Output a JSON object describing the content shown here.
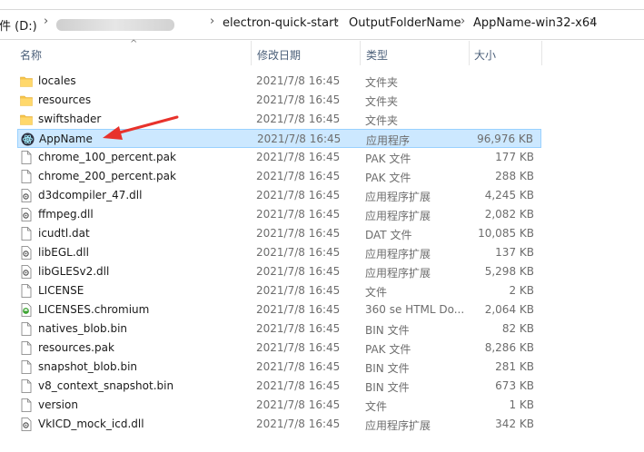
{
  "breadcrumb": {
    "drive_label": "文件 (D:)",
    "segments": [
      "electron-quick-start",
      "OutputFolderName",
      "AppName-win32-x64"
    ]
  },
  "columns": {
    "name": "名称",
    "date": "修改日期",
    "type": "类型",
    "size": "大小"
  },
  "files": [
    {
      "name": "locales",
      "date": "2021/7/8 16:45",
      "type": "文件夹",
      "size": "",
      "icon": "folder-icon"
    },
    {
      "name": "resources",
      "date": "2021/7/8 16:45",
      "type": "文件夹",
      "size": "",
      "icon": "folder-icon"
    },
    {
      "name": "swiftshader",
      "date": "2021/7/8 16:45",
      "type": "文件夹",
      "size": "",
      "icon": "folder-icon"
    },
    {
      "name": "AppName",
      "date": "2021/7/8 16:45",
      "type": "应用程序",
      "size": "96,976 KB",
      "icon": "electron-app-icon",
      "selected": true
    },
    {
      "name": "chrome_100_percent.pak",
      "date": "2021/7/8 16:45",
      "type": "PAK 文件",
      "size": "177 KB",
      "icon": "file-icon"
    },
    {
      "name": "chrome_200_percent.pak",
      "date": "2021/7/8 16:45",
      "type": "PAK 文件",
      "size": "288 KB",
      "icon": "file-icon"
    },
    {
      "name": "d3dcompiler_47.dll",
      "date": "2021/7/8 16:45",
      "type": "应用程序扩展",
      "size": "4,245 KB",
      "icon": "dll-icon"
    },
    {
      "name": "ffmpeg.dll",
      "date": "2021/7/8 16:45",
      "type": "应用程序扩展",
      "size": "2,082 KB",
      "icon": "dll-icon"
    },
    {
      "name": "icudtl.dat",
      "date": "2021/7/8 16:45",
      "type": "DAT 文件",
      "size": "10,085 KB",
      "icon": "file-icon"
    },
    {
      "name": "libEGL.dll",
      "date": "2021/7/8 16:45",
      "type": "应用程序扩展",
      "size": "137 KB",
      "icon": "dll-icon"
    },
    {
      "name": "libGLESv2.dll",
      "date": "2021/7/8 16:45",
      "type": "应用程序扩展",
      "size": "5,298 KB",
      "icon": "dll-icon"
    },
    {
      "name": "LICENSE",
      "date": "2021/7/8 16:45",
      "type": "文件",
      "size": "2 KB",
      "icon": "file-icon"
    },
    {
      "name": "LICENSES.chromium",
      "date": "2021/7/8 16:45",
      "type": "360 se HTML Do...",
      "size": "2,064 KB",
      "icon": "html-doc-icon"
    },
    {
      "name": "natives_blob.bin",
      "date": "2021/7/8 16:45",
      "type": "BIN 文件",
      "size": "82 KB",
      "icon": "file-icon"
    },
    {
      "name": "resources.pak",
      "date": "2021/7/8 16:45",
      "type": "PAK 文件",
      "size": "8,286 KB",
      "icon": "file-icon"
    },
    {
      "name": "snapshot_blob.bin",
      "date": "2021/7/8 16:45",
      "type": "BIN 文件",
      "size": "281 KB",
      "icon": "file-icon"
    },
    {
      "name": "v8_context_snapshot.bin",
      "date": "2021/7/8 16:45",
      "type": "BIN 文件",
      "size": "673 KB",
      "icon": "file-icon"
    },
    {
      "name": "version",
      "date": "2021/7/8 16:45",
      "type": "文件",
      "size": "1 KB",
      "icon": "file-icon"
    },
    {
      "name": "VkICD_mock_icd.dll",
      "date": "2021/7/8 16:45",
      "type": "应用程序扩展",
      "size": "342 KB",
      "icon": "dll-icon"
    }
  ],
  "colors": {
    "selection_bg": "#cce8ff",
    "selection_border": "#99d1ff",
    "folder": "#f7c54a",
    "annotation_arrow": "#e8322b"
  }
}
